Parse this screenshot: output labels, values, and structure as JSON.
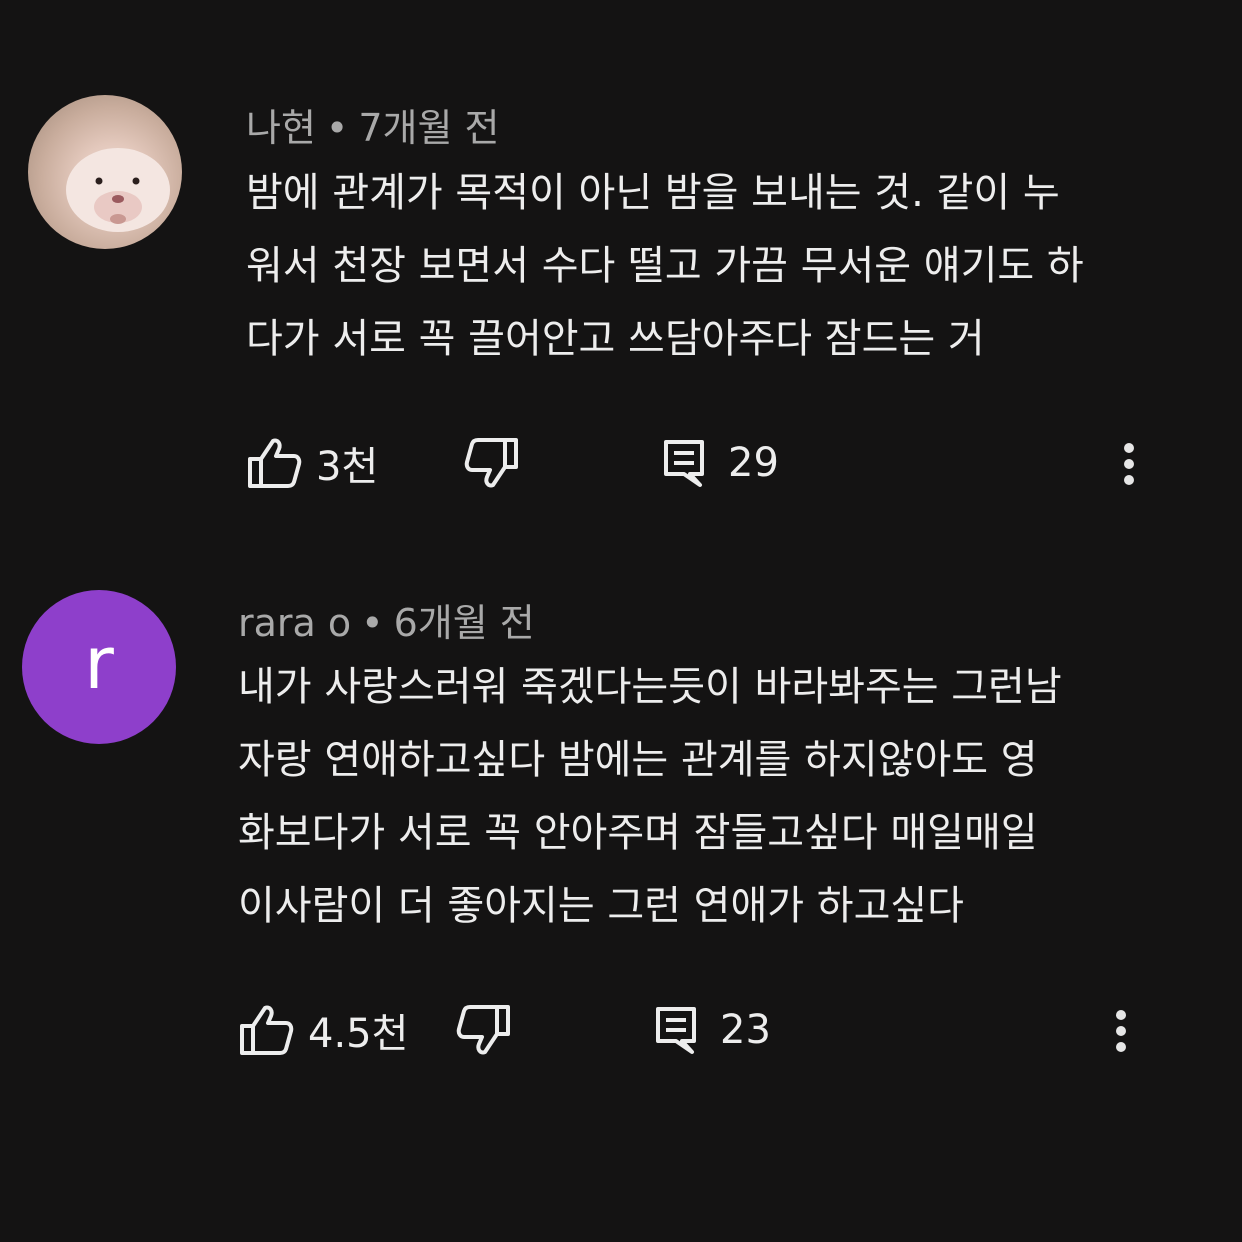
{
  "comments": [
    {
      "author": "나현",
      "separator": "•",
      "time": "7개월 전",
      "avatar_letter": "",
      "avatar_color": "#d9bfb2",
      "text_lines": [
        "밤에 관계가 목적이 아닌 밤을 보내는 것. 같이 누",
        "워서 천장 보면서 수다 떨고 가끔 무서운 얘기도 하",
        "다가 서로 꼭 끌어안고 쓰담아주다 잠드는 거"
      ],
      "likes": "3천",
      "replies": "29",
      "icons": [
        "thumbs-up-icon",
        "thumbs-down-icon",
        "reply-icon",
        "more-vert-icon"
      ]
    },
    {
      "author": "rara o",
      "separator": "•",
      "time": "6개월 전",
      "avatar_letter": "r",
      "avatar_color": "#8e3fcb",
      "text_lines": [
        "내가 사랑스러워 죽겠다는듯이 바라봐주는 그런남",
        "자랑 연애하고싶다 밤에는 관계를 하지않아도 영",
        "화보다가 서로 꼭 안아주며 잠들고싶다 매일매일",
        "이사람이 더 좋아지는 그런 연애가 하고싶다"
      ],
      "likes": "4.5천",
      "replies": "23",
      "icons": [
        "thumbs-up-icon",
        "thumbs-down-icon",
        "reply-icon",
        "more-vert-icon"
      ]
    }
  ],
  "colors": {
    "background": "#141313",
    "text": "#ededed",
    "meta": "#a9a9a9"
  }
}
